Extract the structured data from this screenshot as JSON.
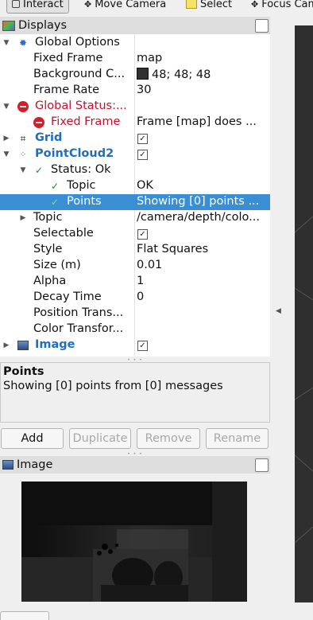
{
  "toolbar": {
    "tools": [
      "Interact",
      "Move Camera",
      "Select",
      "Focus Camera"
    ]
  },
  "displays_panel": {
    "title": "Displays"
  },
  "tree": {
    "rows": [
      {
        "name": "Global Options",
        "value": ""
      },
      {
        "name": "Fixed Frame",
        "value": "map"
      },
      {
        "name": "Background C...",
        "value": "48; 48; 48"
      },
      {
        "name": "Frame Rate",
        "value": "30"
      },
      {
        "name": "Global Status:...",
        "value": ""
      },
      {
        "name": "Fixed Frame",
        "value": "Frame [map] does ..."
      },
      {
        "name": "Grid",
        "value": "checked"
      },
      {
        "name": "PointCloud2",
        "value": "checked"
      },
      {
        "name": "Status: Ok",
        "value": ""
      },
      {
        "name": "Topic",
        "value": "OK"
      },
      {
        "name": "Points",
        "value": "Showing [0] points ..."
      },
      {
        "name": "Topic",
        "value": "/camera/depth/colo..."
      },
      {
        "name": "Selectable",
        "value": "checked"
      },
      {
        "name": "Style",
        "value": "Flat Squares"
      },
      {
        "name": "Size (m)",
        "value": "0.01"
      },
      {
        "name": "Alpha",
        "value": "1"
      },
      {
        "name": "Decay Time",
        "value": "0"
      },
      {
        "name": "Position Trans...",
        "value": ""
      },
      {
        "name": "Color Transfor...",
        "value": ""
      },
      {
        "name": "Image",
        "value": "checked"
      }
    ],
    "background_color_swatch": "#303030",
    "error_color": "#c8102e",
    "display_name_color": "#1f6fc0",
    "selection_color": "#3a8fd4"
  },
  "description": {
    "title": "Points",
    "text": "Showing [0] points from [0] messages"
  },
  "buttons": {
    "add": "Add",
    "duplicate": "Duplicate",
    "remove": "Remove",
    "rename": "Rename"
  },
  "image_panel": {
    "title": "Image"
  }
}
